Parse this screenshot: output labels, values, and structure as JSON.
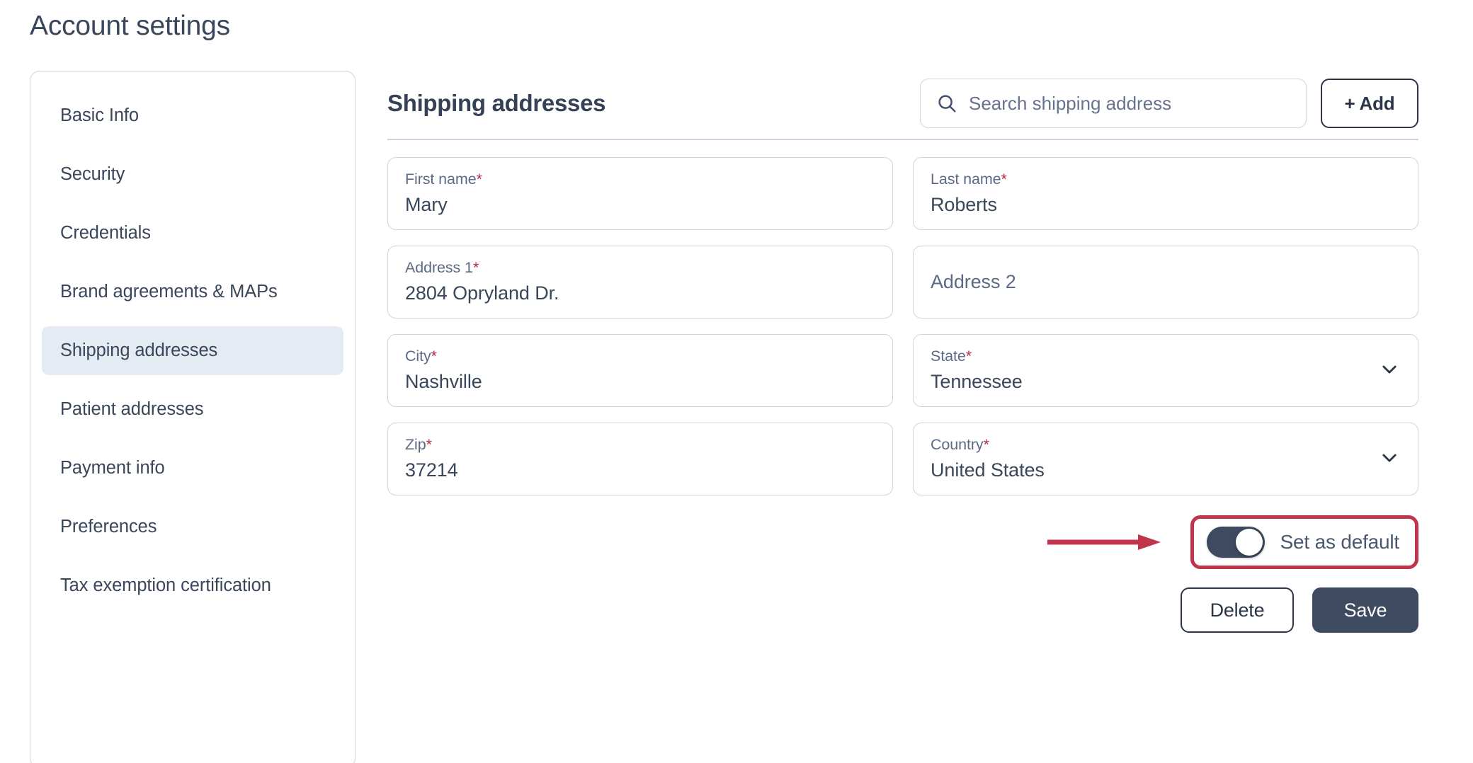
{
  "page": {
    "title": "Account settings"
  },
  "sidebar": {
    "items": [
      {
        "label": "Basic Info",
        "active": false
      },
      {
        "label": "Security",
        "active": false
      },
      {
        "label": "Credentials",
        "active": false
      },
      {
        "label": "Brand agreements & MAPs",
        "active": false
      },
      {
        "label": "Shipping addresses",
        "active": true
      },
      {
        "label": "Patient addresses",
        "active": false
      },
      {
        "label": "Payment info",
        "active": false
      },
      {
        "label": "Preferences",
        "active": false
      },
      {
        "label": "Tax exemption certification",
        "active": false
      }
    ]
  },
  "main": {
    "section_title": "Shipping addresses",
    "search": {
      "placeholder": "Search shipping address",
      "value": "",
      "icon": "search-icon"
    },
    "add_button": {
      "label": "+ Add"
    },
    "fields": [
      {
        "label": "First name",
        "required": true,
        "value": "Mary",
        "type": "text",
        "placeholder": ""
      },
      {
        "label": "Last name",
        "required": true,
        "value": "Roberts",
        "type": "text",
        "placeholder": ""
      },
      {
        "label": "Address 1",
        "required": true,
        "value": "2804 Opryland Dr.",
        "type": "text",
        "placeholder": ""
      },
      {
        "label": "Address 2",
        "required": false,
        "value": "",
        "type": "text",
        "placeholder": "Address 2"
      },
      {
        "label": "City",
        "required": true,
        "value": "Nashville",
        "type": "text",
        "placeholder": ""
      },
      {
        "label": "State",
        "required": true,
        "value": "Tennessee",
        "type": "select",
        "placeholder": ""
      },
      {
        "label": "Zip",
        "required": true,
        "value": "37214",
        "type": "text",
        "placeholder": ""
      },
      {
        "label": "Country",
        "required": true,
        "value": "United States",
        "type": "select",
        "placeholder": ""
      }
    ],
    "toggle": {
      "label": "Set as default",
      "on": true
    },
    "buttons": {
      "delete": "Delete",
      "save": "Save"
    }
  },
  "annotation": {
    "color": "#c2334c",
    "shape": "arrow-and-box",
    "target": "set-as-default-toggle"
  },
  "colors": {
    "text_primary": "#3a465a",
    "text_secondary": "#5c6a85",
    "border": "#ccd5e1",
    "active_bg": "#e4ebf3",
    "required_asterisk": "#b32b45",
    "toggle_on": "#3d4a5f",
    "save_bg": "#3d4a5f",
    "annotation_red": "#c2334c"
  }
}
